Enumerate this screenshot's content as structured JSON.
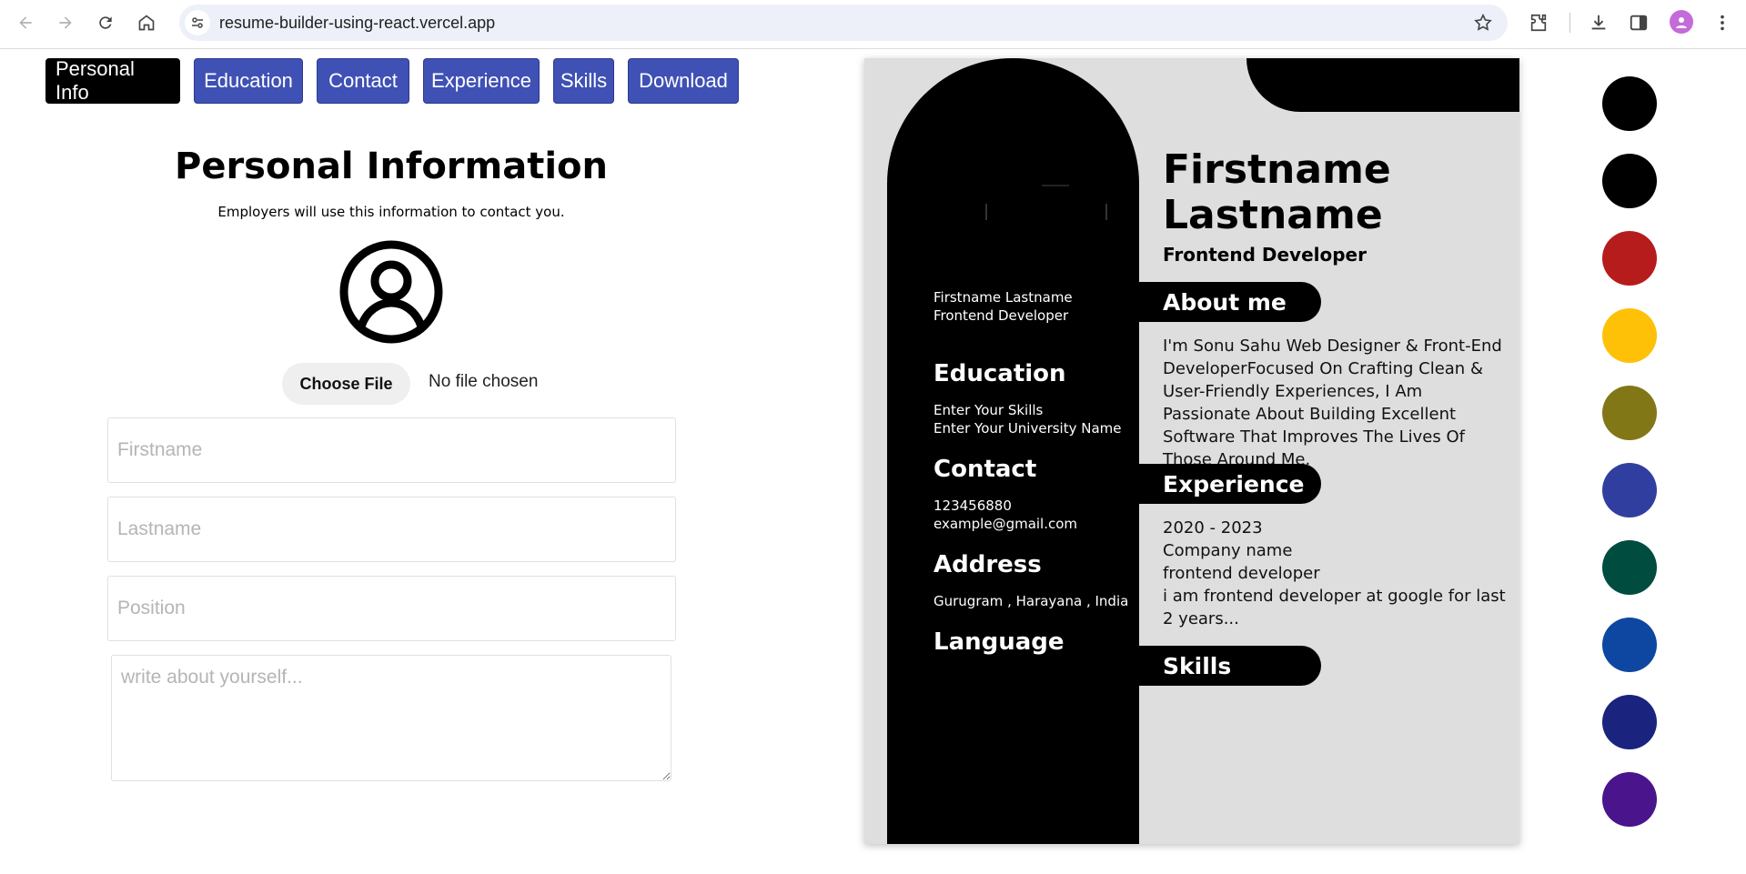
{
  "browser": {
    "url": "resume-builder-using-react.vercel.app"
  },
  "tabs": [
    {
      "label": "Personal Info",
      "active": true
    },
    {
      "label": "Education",
      "active": false
    },
    {
      "label": "Contact",
      "active": false
    },
    {
      "label": "Experience",
      "active": false
    },
    {
      "label": "Skills",
      "active": false
    },
    {
      "label": "Download",
      "active": false
    }
  ],
  "form": {
    "title": "Personal Information",
    "subtitle": "Employers will use this information to contact you.",
    "choose_file_label": "Choose File",
    "no_file_text": "No file chosen",
    "firstname_placeholder": "Firstname",
    "lastname_placeholder": "Lastname",
    "position_placeholder": "Position",
    "about_placeholder": "write about yourself..."
  },
  "resume": {
    "sidebar_name": "Firstname Lastname",
    "sidebar_position": "Frontend Developer",
    "education_heading": "Education",
    "education_line1": "Enter Your Skills",
    "education_line2": "Enter Your University Name",
    "contact_heading": "Contact",
    "phone": "123456880",
    "email": "example@gmail.com",
    "address_heading": "Address",
    "address": "Gurugram , Harayana , India",
    "language_heading": "Language",
    "first_name": "Firstname",
    "last_name": "Lastname",
    "position": "Frontend Developer",
    "about_heading": "About me",
    "about_text": "I'm Sonu Sahu Web Designer & Front-End DeveloperFocused On Crafting Clean & User-Friendly Experiences, I Am Passionate About Building Excellent Software That Improves The Lives Of Those Around Me.",
    "experience_heading": "Experience",
    "exp_years": "2020 - 2023",
    "exp_company": "Company name",
    "exp_role": "frontend developer",
    "exp_desc": "i am frontend developer at google for last 2 years...",
    "skills_heading": "Skills"
  },
  "palette": [
    "#000000",
    "#000000",
    "#b71c1c",
    "#ffc107",
    "#827717",
    "#303f9f",
    "#004d40",
    "#0d47a1",
    "#1a237e",
    "#4a148c"
  ]
}
